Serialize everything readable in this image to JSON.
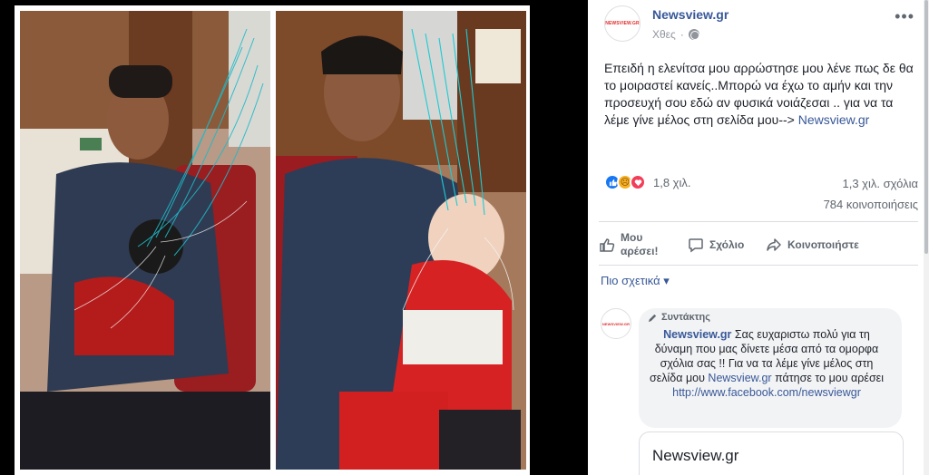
{
  "photos": [
    {
      "alt": "left-photo"
    },
    {
      "alt": "right-photo"
    }
  ],
  "post": {
    "page_name": "Newsview.gr",
    "avatar_text": "NEWSVIEW.GR",
    "time": "Χθες",
    "more_label": "•••",
    "text_part1": "Επειδή η ελενίτσα μου αρρώστησε μου λένε πως δε θα το μοιραστεί κανείς..Μπορώ να έχω το αμήν και την προσευχή σου εδώ αν φυσικά νοιάζεσαι .. για να τα λέμε γίνε μέλος στη σελίδα μου-->",
    "text_link": "Newsview.gr"
  },
  "stats": {
    "reactions_count": "1,8 χιλ.",
    "comments_count": "1,3 χιλ. σχόλια",
    "shares_count": "784 κοινοποιήσεις",
    "reaction_icons": [
      "like-icon",
      "sad-icon",
      "love-icon"
    ]
  },
  "actions": {
    "like_line1": "Μου",
    "like_line2": "αρέσει!",
    "comment": "Σχόλιο",
    "share": "Κοινοποιήστε"
  },
  "filter": {
    "label": "Πιο σχετικά ▾"
  },
  "comment": {
    "badge": "Συντάκτης",
    "author": "Newsview.gr",
    "text1": " Σας ευχαριστω πολύ για τη δύναμη που μας δίνετε μέσα από τα ομορφα σχόλια σας !! Για να τα λέμε γίνε μέλος στη σελίδα μου ",
    "inline_link": "Newsview.gr",
    "text2": " πάτησε το μου αρέσει",
    "url": "http://www.facebook.com/newsviewgr"
  },
  "link_card": {
    "title": "Newsview.gr"
  },
  "colors": {
    "link": "#385898",
    "text": "#1d2129",
    "muted": "#606770",
    "bubble": "#f2f3f5"
  }
}
